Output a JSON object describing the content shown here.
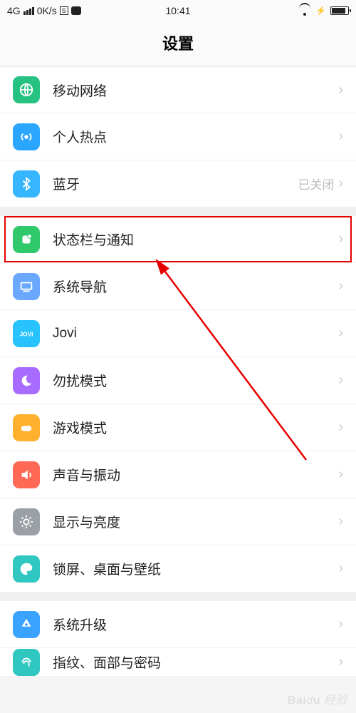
{
  "statusbar": {
    "net_type": "4G",
    "speed": "0K/s",
    "time": "10:41"
  },
  "title": "设置",
  "rows": {
    "mobile": {
      "label": "移动网络"
    },
    "hotspot": {
      "label": "个人热点"
    },
    "bt": {
      "label": "蓝牙",
      "value": "已关闭"
    },
    "status": {
      "label": "状态栏与通知"
    },
    "nav": {
      "label": "系统导航"
    },
    "jovi": {
      "label": "Jovi"
    },
    "dnd": {
      "label": "勿扰模式"
    },
    "game": {
      "label": "游戏模式"
    },
    "sound": {
      "label": "声音与振动"
    },
    "display": {
      "label": "显示与亮度"
    },
    "lock": {
      "label": "锁屏、桌面与壁纸"
    },
    "update": {
      "label": "系统升级"
    },
    "finger": {
      "label": "指纹、面部与密码"
    }
  },
  "watermark": "Baidu 经验",
  "sbox": "S"
}
